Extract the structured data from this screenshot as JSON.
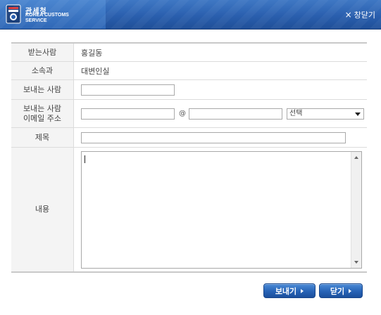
{
  "header": {
    "logo_title": "관세청",
    "logo_sub_line1": "KOREA CUSTOMS",
    "logo_sub_line2": "SERVICE",
    "close_label": "창닫기",
    "close_symbol": "×"
  },
  "form": {
    "recipient": {
      "label": "받는사람",
      "value": "홍길동"
    },
    "department": {
      "label": "소속과",
      "value": "대변인실"
    },
    "sender": {
      "label": "보내는 사람",
      "value": ""
    },
    "sender_email": {
      "label_line1": "보내는 사람",
      "label_line2": "이메일 주소",
      "local_value": "",
      "at_symbol": "@",
      "domain_value": "",
      "domain_select_value": "선택"
    },
    "subject": {
      "label": "제목",
      "value": ""
    },
    "content": {
      "label": "내용",
      "value": ""
    }
  },
  "buttons": {
    "send_label": "보내기",
    "close_label": "닫기"
  },
  "colors": {
    "header_blue": "#2a5fae",
    "button_blue": "#2763b6",
    "label_bg": "#f4f4f4"
  }
}
